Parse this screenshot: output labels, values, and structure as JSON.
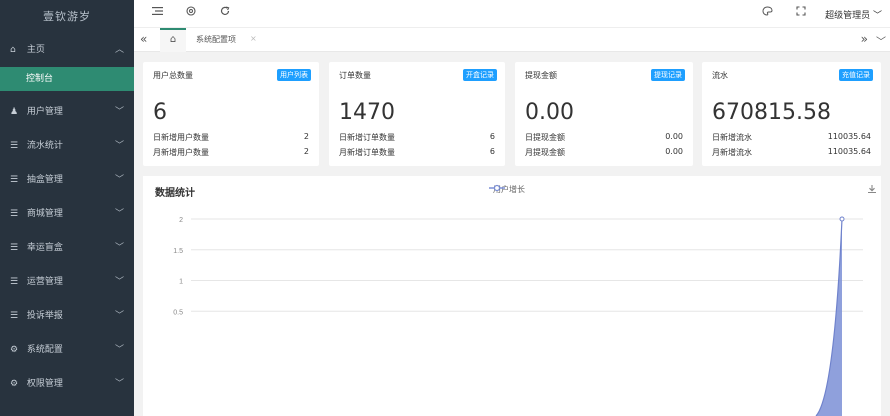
{
  "sidebar": {
    "logo": "壹钦游岁",
    "items": [
      {
        "icon": "home-icon",
        "glyph": "⌂",
        "label": "主页",
        "chevron": "︿"
      },
      {
        "icon": "users-icon",
        "glyph": "♟",
        "label": "用户管理",
        "chevron": "﹀"
      },
      {
        "icon": "list-icon",
        "glyph": "☰",
        "label": "流水统计",
        "chevron": "﹀"
      },
      {
        "icon": "list-icon",
        "glyph": "☰",
        "label": "抽盒管理",
        "chevron": "﹀"
      },
      {
        "icon": "list-icon",
        "glyph": "☰",
        "label": "商城管理",
        "chevron": "﹀"
      },
      {
        "icon": "list-icon",
        "glyph": "☰",
        "label": "幸运盲盒",
        "chevron": "﹀"
      },
      {
        "icon": "list-icon",
        "glyph": "☰",
        "label": "运营管理",
        "chevron": "﹀"
      },
      {
        "icon": "list-icon",
        "glyph": "☰",
        "label": "投诉举报",
        "chevron": "﹀"
      },
      {
        "icon": "settings-icon",
        "glyph": "⚙",
        "label": "系统配置",
        "chevron": "﹀"
      },
      {
        "icon": "permission-icon",
        "glyph": "⚙",
        "label": "权限管理",
        "chevron": "﹀"
      }
    ],
    "active_sub": "控制台"
  },
  "topbar": {
    "user": "超级管理员",
    "user_chevron": "﹀"
  },
  "tabs": {
    "prev": "«",
    "home": "⌂",
    "current": "系统配置项",
    "close": "×",
    "next": "»",
    "more": "﹀"
  },
  "cards": [
    {
      "title": "用户总数量",
      "badge": "用户列表",
      "value": "6",
      "rows": [
        {
          "label": "日新增用户数量",
          "value": "2"
        },
        {
          "label": "月新增用户数量",
          "value": "2"
        }
      ]
    },
    {
      "title": "订单数量",
      "badge": "开盒记录",
      "value": "1470",
      "rows": [
        {
          "label": "日新增订单数量",
          "value": "6"
        },
        {
          "label": "月新增订单数量",
          "value": "6"
        }
      ]
    },
    {
      "title": "提现金额",
      "badge": "提现记录",
      "value": "0.00",
      "rows": [
        {
          "label": "日提现金额",
          "value": "0.00"
        },
        {
          "label": "月提现金额",
          "value": "0.00"
        }
      ]
    },
    {
      "title": "流水",
      "badge": "充值记录",
      "value": "670815.58",
      "rows": [
        {
          "label": "日新增流水",
          "value": "110035.64"
        },
        {
          "label": "月新增流水",
          "value": "110035.64"
        }
      ]
    }
  ],
  "chart_title": "数据统计",
  "colors": {
    "accent": "#2e8b72",
    "badge": "#1e9fff",
    "series": "#7b8fd6"
  },
  "chart_data": {
    "type": "area",
    "legend": "用户增长",
    "y_ticks": [
      "2",
      "1.5",
      "1",
      "0.5"
    ],
    "ylim": [
      0,
      2
    ],
    "series": [
      {
        "name": "用户增长",
        "y_peak": 2
      }
    ]
  }
}
